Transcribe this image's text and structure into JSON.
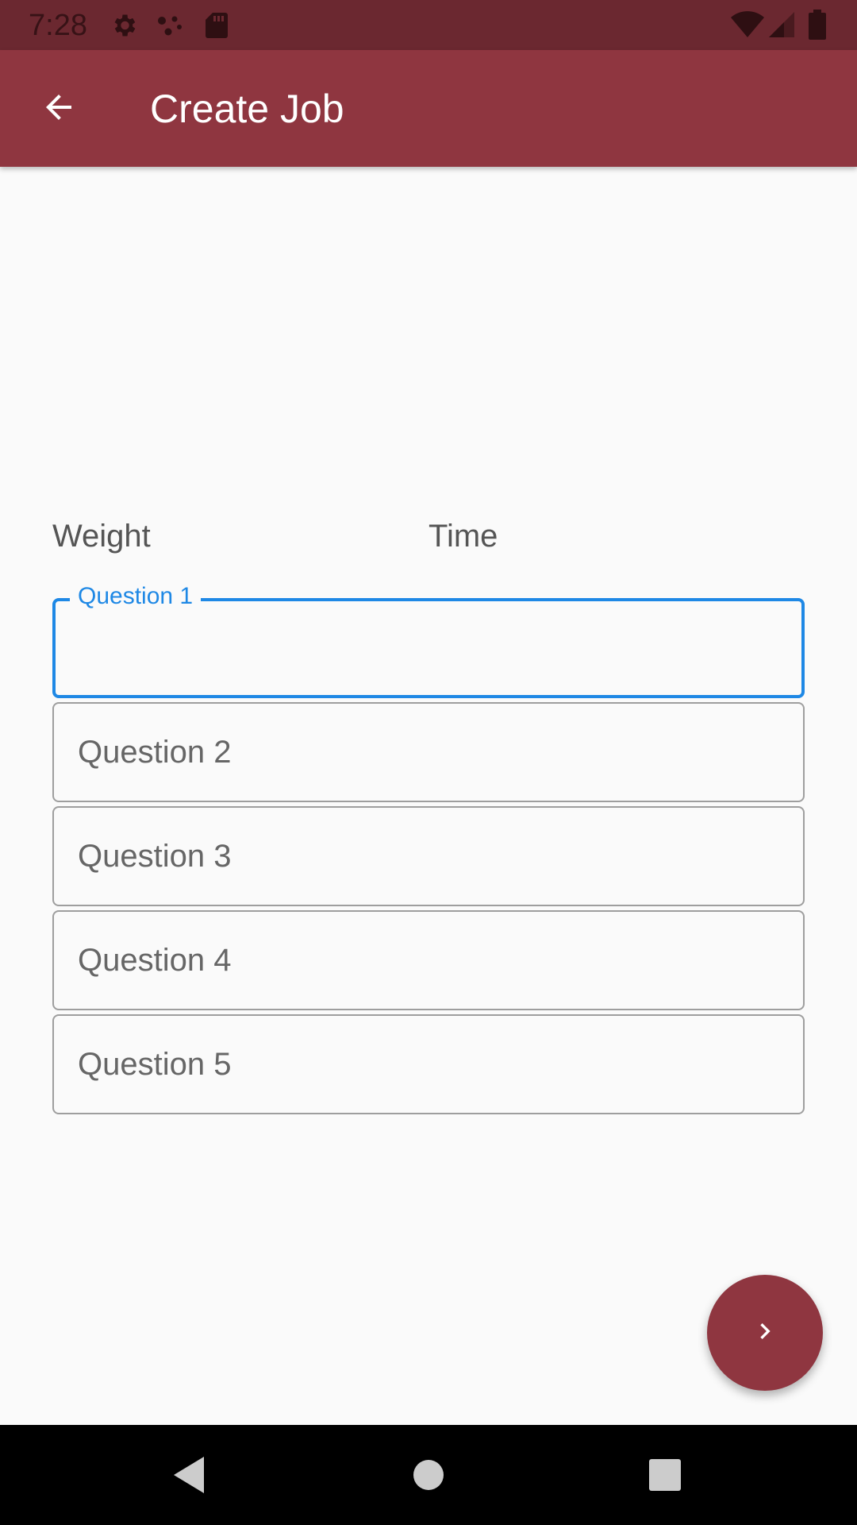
{
  "status_bar": {
    "time": "7:28",
    "icons": [
      "settings-icon",
      "dots-icon",
      "sd-card-icon",
      "wifi-icon",
      "signal-icon",
      "battery-icon"
    ]
  },
  "app_bar": {
    "title": "Create Job",
    "back_icon": "arrow-back-icon",
    "color": "#8f3640"
  },
  "columns": {
    "weight_label": "Weight",
    "time_label": "Time"
  },
  "fields": {
    "q1": {
      "label": "Question 1",
      "value": ""
    },
    "q2": {
      "placeholder": "Question 2",
      "value": ""
    },
    "q3": {
      "placeholder": "Question 3",
      "value": ""
    },
    "q4": {
      "placeholder": "Question 4",
      "value": ""
    },
    "q5": {
      "placeholder": "Question 5",
      "value": ""
    }
  },
  "fab": {
    "icon": "chevron-right-icon",
    "color": "#8f3640"
  },
  "nav_bar": {
    "icons": [
      "back-triangle-icon",
      "home-circle-icon",
      "recents-square-icon"
    ]
  },
  "colors": {
    "focus": "#1e88e5",
    "status_bar": "#6b2830"
  }
}
